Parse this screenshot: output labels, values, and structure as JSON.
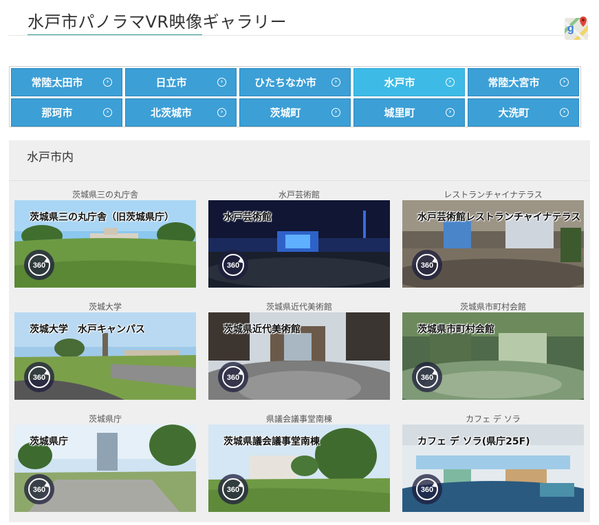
{
  "header": {
    "title": "水戸市パノラマVR映像ギャラリー",
    "maps_icon": "google-maps-icon"
  },
  "cities": [
    {
      "label": "常陸太田市",
      "active": false
    },
    {
      "label": "日立市",
      "active": false
    },
    {
      "label": "ひたちなか市",
      "active": false
    },
    {
      "label": "水戸市",
      "active": true
    },
    {
      "label": "常陸大宮市",
      "active": false
    },
    {
      "label": "那珂市",
      "active": false
    },
    {
      "label": "北茨城市",
      "active": false
    },
    {
      "label": "茨城町",
      "active": false
    },
    {
      "label": "城里町",
      "active": false
    },
    {
      "label": "大洗町",
      "active": false
    }
  ],
  "section": {
    "title": "水戸市内"
  },
  "gallery": [
    {
      "caption": "茨城県三の丸庁舎",
      "overlay": "茨城県三の丸庁舎（旧茨城県庁）",
      "badge": "360"
    },
    {
      "caption": "水戸芸術館",
      "overlay": "水戸芸術館",
      "badge": "360"
    },
    {
      "caption": "レストランチャイナテラス",
      "overlay": "水戸芸術館レストランチャイナテラス",
      "badge": "360"
    },
    {
      "caption": "茨城大学",
      "overlay": "茨城大学　水戸キャンパス",
      "badge": "360"
    },
    {
      "caption": "茨城県近代美術館",
      "overlay": "茨城県近代美術館",
      "badge": "360"
    },
    {
      "caption": "茨城県市町村会館",
      "overlay": "茨城県市町村会館",
      "badge": "360"
    },
    {
      "caption": "茨城県庁",
      "overlay": "茨城県庁",
      "badge": "360"
    },
    {
      "caption": "県議会議事堂南棟",
      "overlay": "茨城県議会議事堂南棟",
      "badge": "360"
    },
    {
      "caption": "カフェ デ ソラ",
      "overlay": "カフェ デ ソラ(県庁25F)",
      "badge": "360"
    }
  ],
  "colors": {
    "button": "#3c9fd6",
    "button_active": "#3dbbe6",
    "title_underline": "#2b9b8f"
  }
}
